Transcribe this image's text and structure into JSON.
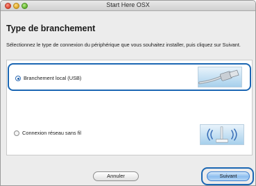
{
  "window": {
    "title": "Start Here OSX"
  },
  "page": {
    "title": "Type de branchement",
    "instructions": "Sélectionnez le type de connexion du périphérique que vous souhaitez installer, puis cliquez sur Suivant."
  },
  "options": [
    {
      "label": "Branchement local (USB)",
      "selected": true,
      "icon": "usb-cable-icon"
    },
    {
      "label": "Connexion réseau sans fil",
      "selected": false,
      "icon": "wireless-router-icon"
    }
  ],
  "buttons": {
    "cancel_label": "Annuler",
    "next_label": "Suivant"
  },
  "colors": {
    "highlight": "#1a66b3",
    "default_button": "#8cbdef"
  }
}
